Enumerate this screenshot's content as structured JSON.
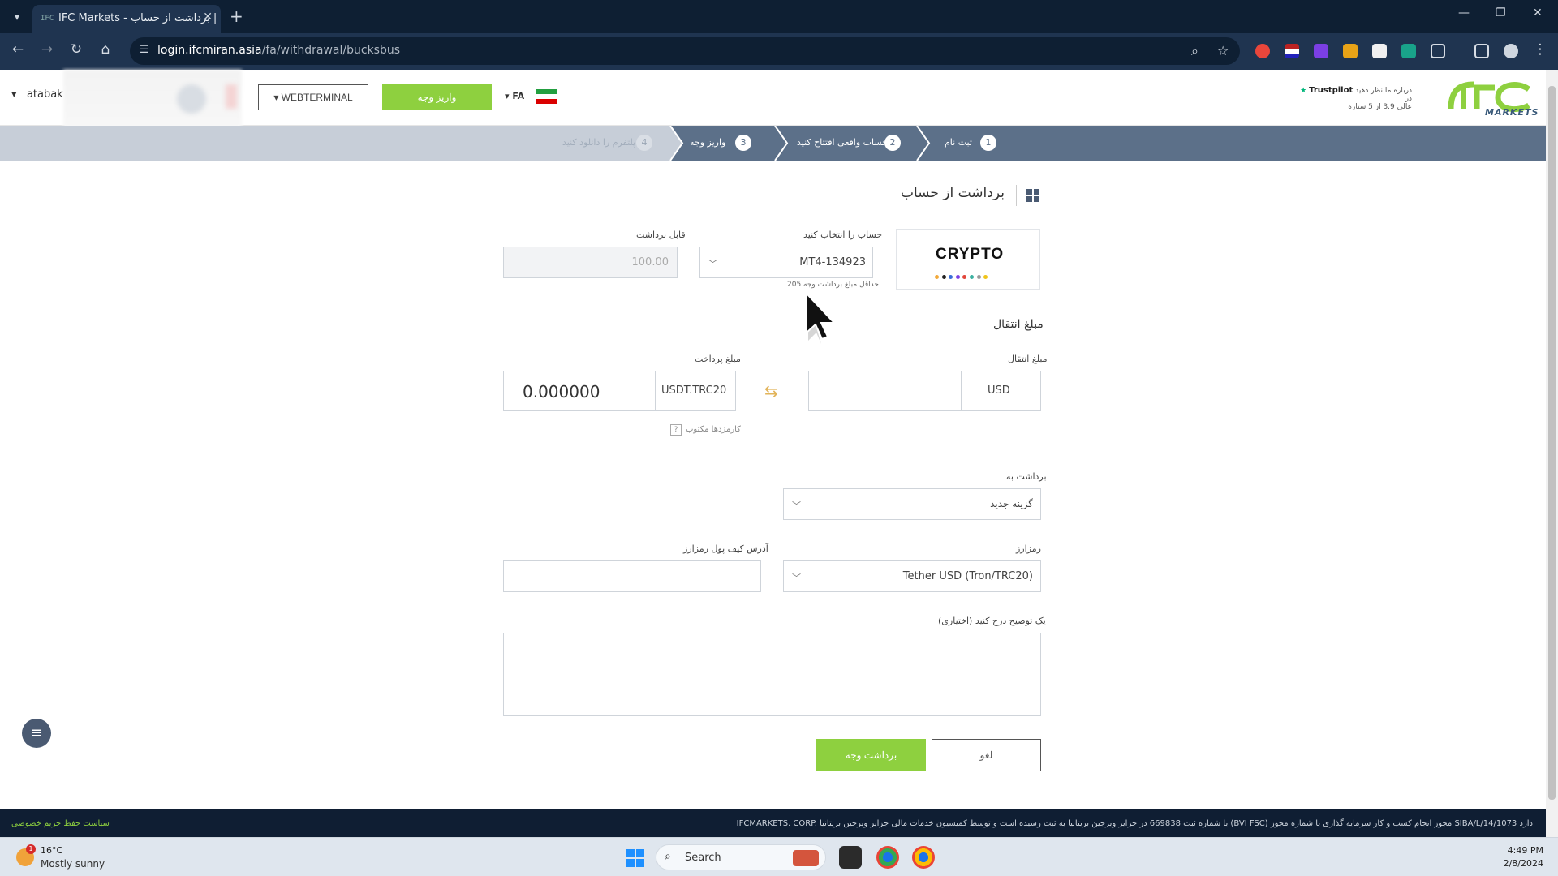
{
  "browser": {
    "tab_title": "IFC Markets - برداشت از حساب |",
    "tab_favicon": "IFC",
    "url_host": "login.ifcmiran.asia",
    "url_path": "/fa/withdrawal/bucksbus"
  },
  "header": {
    "logo_text": "MARKETS",
    "trustpilot_brand": "Trustpilot",
    "trustpilot_line1": "درباره ما نظر دهید در",
    "trustpilot_line2": "عالی 3.9 از 5 ستاره",
    "lang": "FA",
    "deposit_button": "واریز وجه",
    "webterminal_button": "WEBTERMINAL",
    "user_name": "atabak"
  },
  "steps": [
    {
      "num": "1",
      "label": "ثبت نام"
    },
    {
      "num": "2",
      "label": "حساب واقعی افتتاح کنید"
    },
    {
      "num": "3",
      "label": "واریز وجه"
    },
    {
      "num": "4",
      "label": "پلتفرم را دانلود کنید"
    }
  ],
  "page": {
    "title": "برداشت از حساب",
    "crypto_label": "CRYPTO",
    "account_label": "حساب را انتخاب کنید",
    "account_value": "MT4-134923",
    "min_withdraw_note": "حداقل مبلغ برداشت وجه 205",
    "available_label": "قابل برداشت",
    "available_value": "100.00",
    "transfer_section_title": "مبلغ انتقال",
    "transfer_amount_label": "مبلغ انتقال",
    "transfer_currency": "USD",
    "payment_amount_label": "مبلغ پرداخت",
    "payment_currency": "USDT.TRC20",
    "payment_value": "0.000000",
    "frozen_note": "کارمزدها مکتوب",
    "withdraw_to_label": "برداشت به",
    "withdraw_to_value": "گزینه جدید",
    "crypto_select_label": "رمزارز",
    "crypto_select_value": "Tether USD (Tron/TRC20)",
    "wallet_label": "آدرس کیف پول رمزارز",
    "wallet_value": "",
    "comment_label": "یک توضیح درج کنید (اختیاری)",
    "withdraw_button": "برداشت وجه",
    "cancel_button": "لغو"
  },
  "footer": {
    "text": "IFCMARKETS. CORP. با شماره ثبت 669838 در جزایر ویرجین بریتانیا به ثبت رسیده است و توسط کمیسیون خدمات مالی جزایر ویرجین بریتانیا (BVI FSC) مجوز انجام کسب و کار سرمایه گذاری با شماره مجوز SIBA/L/14/1073 دارد",
    "privacy_link": "سیاست حفظ حریم خصوصی"
  },
  "taskbar": {
    "temp": "16°C",
    "weather": "Mostly sunny",
    "weather_badge": "1",
    "search": "Search",
    "time": "4:49 PM",
    "date": "2/8/2024"
  },
  "colors": {
    "accent_green": "#8ed03f",
    "steps_bar": "#c7ced8",
    "step_active": "#5c7089",
    "footer_bg": "#0f1e33"
  }
}
